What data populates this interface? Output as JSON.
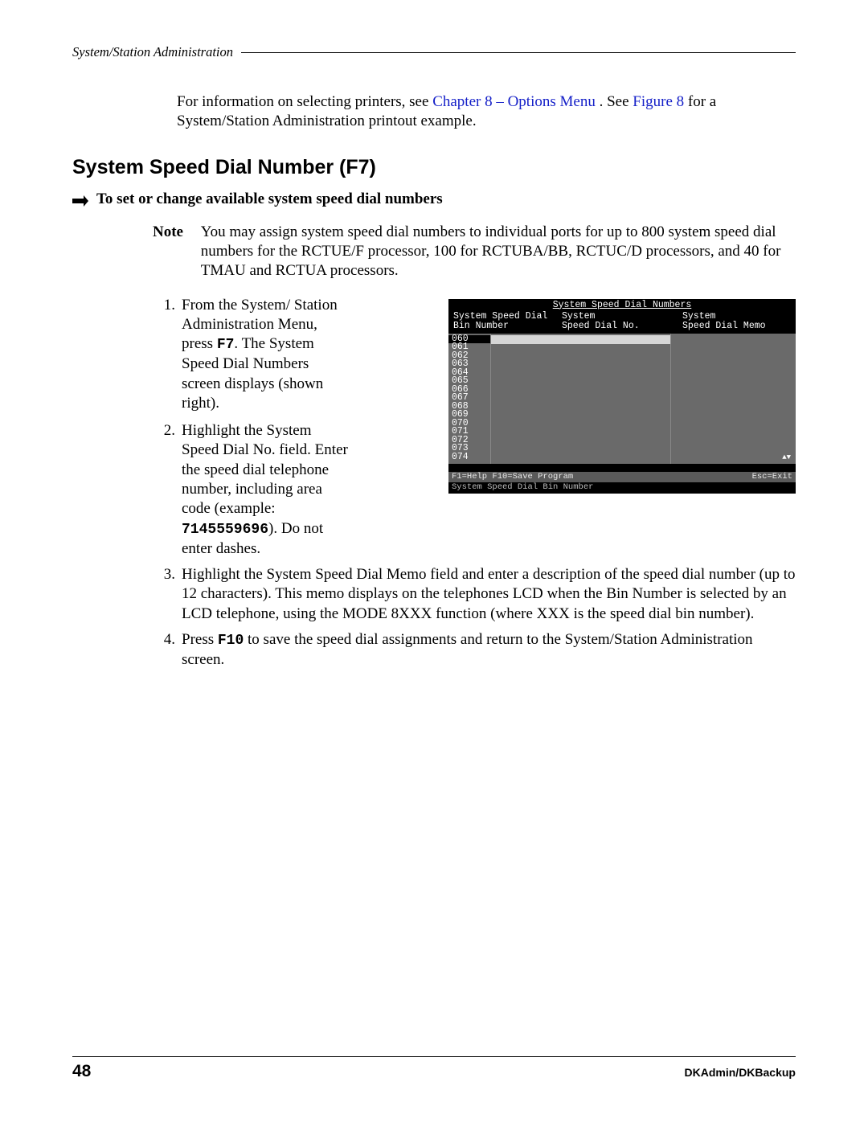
{
  "header": "System/Station Administration",
  "intro": {
    "pre": "For information on selecting printers, see ",
    "link1": "Chapter 8 – Options Menu",
    "mid": ". See ",
    "link2": "Figure 8",
    "post": " for a System/Station Administration printout example."
  },
  "section_title": "System Speed Dial Number (F7)",
  "subhead": "To set or change available system speed dial numbers",
  "note": {
    "label": "Note",
    "body": "You may assign system speed dial numbers to individual ports for up to 800 system speed dial numbers for the RCTUE/F processor, 100 for RCTUBA/BB, RCTUC/D processors, and 40 for TMAU and RCTUA processors."
  },
  "steps": {
    "s1": {
      "num": "1.",
      "a": "From the System/ Station Administration Menu, press ",
      "key": "F7",
      "b": ". The System Speed Dial Numbers screen displays (shown right)."
    },
    "s2": {
      "num": "2.",
      "a": "Highlight the System Speed Dial No. field. Enter the speed dial telephone number, including area code (example: ",
      "key": "7145559696",
      "b": "). Do not enter dashes."
    },
    "s3": {
      "num": "3.",
      "text": "Highlight the System Speed Dial Memo field and enter a description of the speed dial number (up to 12 characters). This memo displays on the telephones LCD when the Bin Number is selected by an LCD telephone, using the MODE 8XXX function (where XXX is the speed dial bin number)."
    },
    "s4": {
      "num": "4.",
      "a": "Press ",
      "key": "F10",
      "b": " to save the speed dial assignments and return to the System/Station Administration screen."
    }
  },
  "screenshot": {
    "title": "System Speed Dial Numbers",
    "col1a": "System Speed Dial",
    "col1b": "Bin Number",
    "col2a": "System",
    "col2b": "Speed Dial No.",
    "col3a": "System",
    "col3b": "Speed Dial Memo",
    "bins": [
      "060",
      "061",
      "062",
      "063",
      "064",
      "065",
      "066",
      "067",
      "068",
      "069",
      "070",
      "071",
      "072",
      "073",
      "074"
    ],
    "scroll": "▲▼",
    "footer_left": "F1=Help  F10=Save Program",
    "footer_right": "Esc=Exit",
    "footer2": "System Speed Dial Bin Number"
  },
  "footer": {
    "page": "48",
    "doc": "DKAdmin/DKBackup"
  }
}
